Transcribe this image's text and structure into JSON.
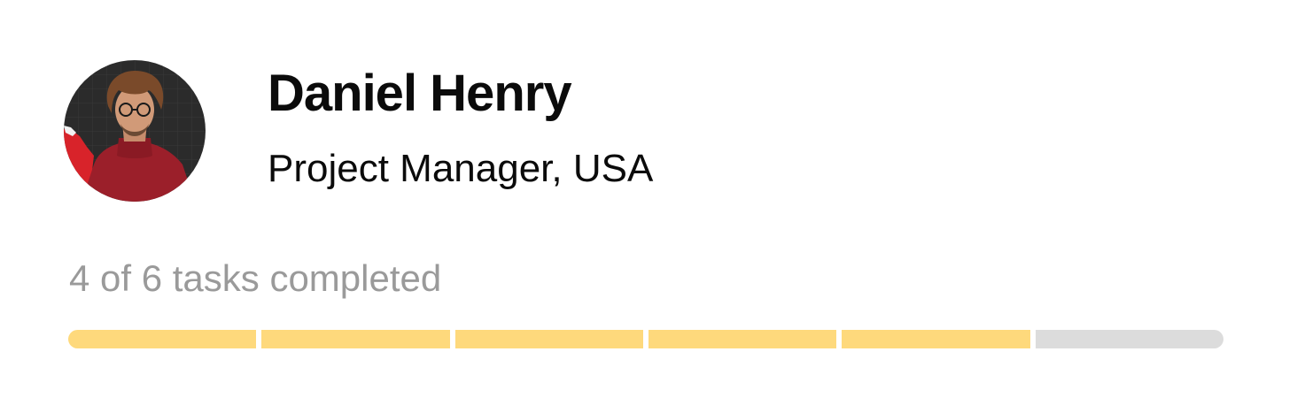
{
  "profile": {
    "name": "Daniel Henry",
    "role": "Project Manager, USA",
    "avatar_icon": "profile-photo"
  },
  "tasks": {
    "summary": "4 of 6 tasks completed",
    "segment_states": [
      "done",
      "done",
      "done",
      "done",
      "done",
      "pending"
    ],
    "completed_fraction": 0.833
  },
  "colors": {
    "segment_done": "#fed97c",
    "segment_pending": "#dcdcdc",
    "name_text": "#0b0b0b",
    "summary_text": "#9a9a9a"
  }
}
